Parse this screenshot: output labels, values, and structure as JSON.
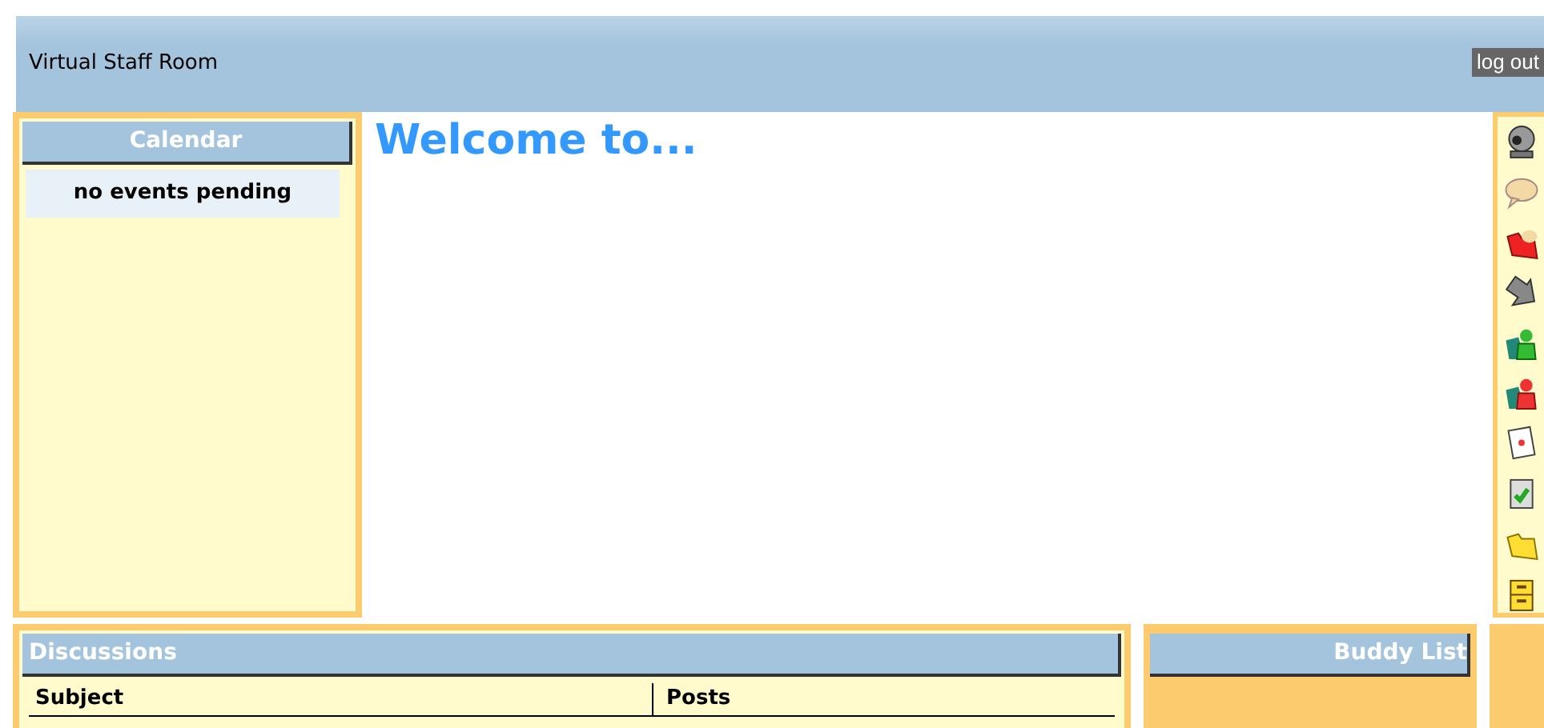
{
  "header": {
    "title": "Virtual Staff Room",
    "logout": "log out"
  },
  "calendar": {
    "title": "Calendar",
    "empty": "no events pending"
  },
  "welcome": "Welcome to...",
  "toolbar": [
    {
      "kind": "webcam"
    },
    {
      "kind": "speech"
    },
    {
      "kind": "redfolder"
    },
    {
      "kind": "arrow"
    },
    {
      "kind": "greenuser"
    },
    {
      "kind": "reduser"
    },
    {
      "kind": "page"
    },
    {
      "kind": "check"
    },
    {
      "kind": "folder"
    },
    {
      "kind": "cabinet"
    }
  ],
  "discussions": {
    "title": "Discussions",
    "columns": [
      "Subject",
      "Posts"
    ]
  },
  "buddy_list": {
    "title": "Buddy List"
  }
}
